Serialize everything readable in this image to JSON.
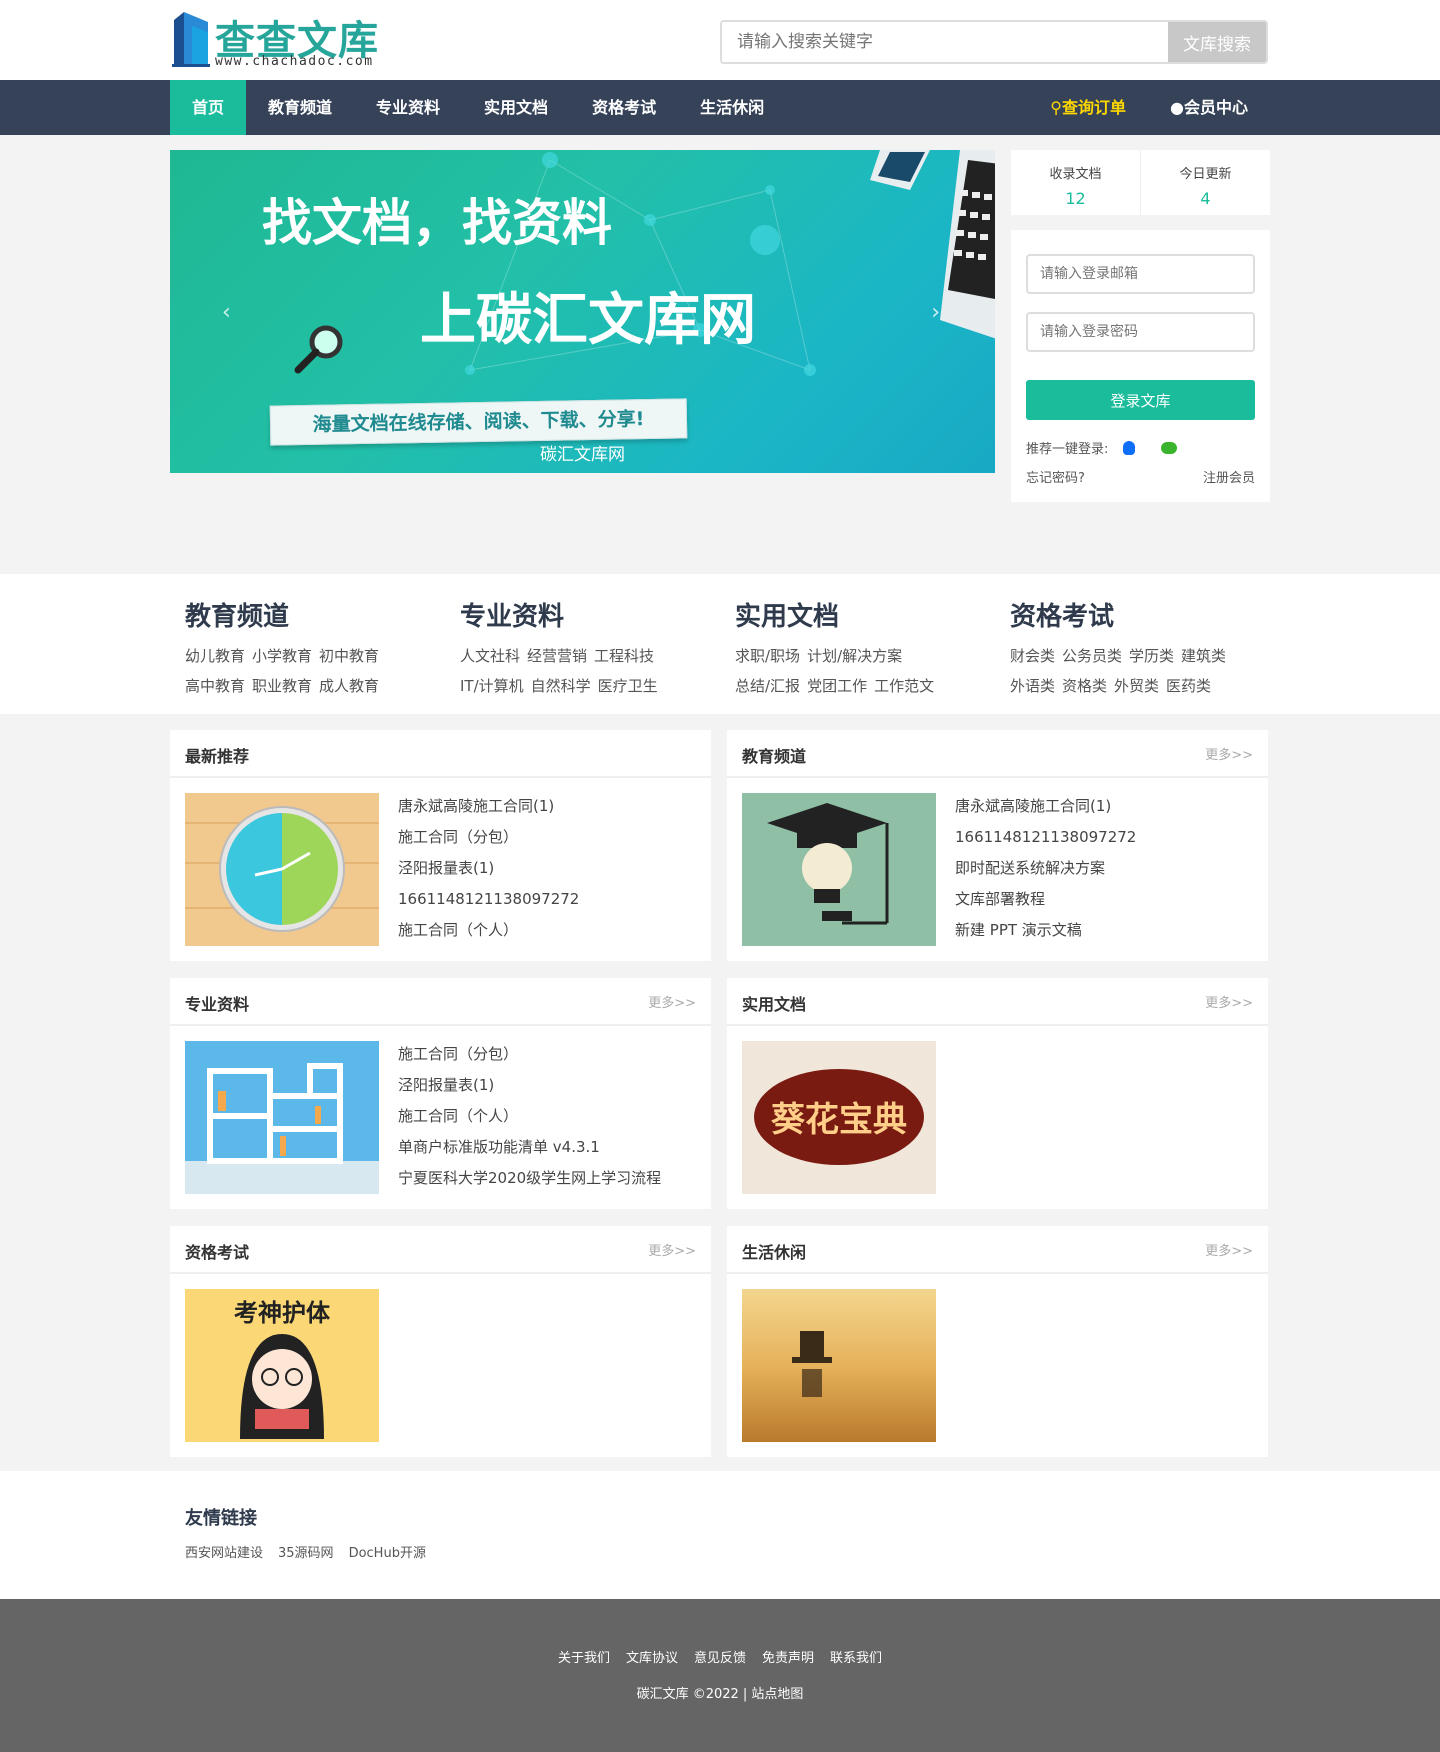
{
  "site": {
    "logo_text": "查查文库",
    "logo_sub": "www.chachadoc.com"
  },
  "search": {
    "placeholder": "请输入搜索关键字",
    "button": "文库搜索"
  },
  "nav": {
    "items": [
      "首页",
      "教育频道",
      "专业资料",
      "实用文档",
      "资格考试",
      "生活休闲"
    ],
    "orders": "查询订单",
    "member": "会员中心"
  },
  "banner": {
    "title1": "找文档，找资料",
    "title2": "上碳汇文库网",
    "ribbon": "海量文档在线存储、阅读、下载、分享!",
    "caption": "碳汇文库网"
  },
  "stats": {
    "docs_label": "收录文档",
    "docs_value": "12",
    "today_label": "今日更新",
    "today_value": "4"
  },
  "login": {
    "email_placeholder": "请输入登录邮箱",
    "password_placeholder": "请输入登录密码",
    "button": "登录文库",
    "social_label": "推荐一键登录:",
    "forgot": "忘记密码?",
    "register": "注册会员"
  },
  "categories": [
    {
      "title": "教育频道",
      "row1": [
        "幼儿教育",
        "小学教育",
        "初中教育"
      ],
      "row2": [
        "高中教育",
        "职业教育",
        "成人教育"
      ]
    },
    {
      "title": "专业资料",
      "row1": [
        "人文社科",
        "经营营销",
        "工程科技"
      ],
      "row2": [
        "IT/计算机",
        "自然科学",
        "医疗卫生"
      ]
    },
    {
      "title": "实用文档",
      "row1": [
        "求职/职场",
        "计划/解决方案"
      ],
      "row2": [
        "总结/汇报",
        "党团工作",
        "工作范文"
      ]
    },
    {
      "title": "资格考试",
      "row1": [
        "财会类",
        "公务员类",
        "学历类",
        "建筑类"
      ],
      "row2": [
        "外语类",
        "资格类",
        "外贸类",
        "医药类"
      ]
    }
  ],
  "panels": [
    {
      "title": "最新推荐",
      "more": "",
      "items": [
        "唐永斌高陵施工合同(1)",
        "施工合同（分包）",
        "泾阳报量表(1)",
        "1661148121138097272",
        "施工合同（个人）"
      ],
      "thumb": "clock"
    },
    {
      "title": "教育频道",
      "more": "更多>>",
      "items": [
        "唐永斌高陵施工合同(1)",
        "1661148121138097272",
        "即时配送系统解决方案",
        "文库部署教程",
        "新建 PPT 演示文稿"
      ],
      "thumb": "graduation"
    },
    {
      "title": "专业资料",
      "more": "更多>>",
      "items": [
        "施工合同（分包）",
        "泾阳报量表(1)",
        "施工合同（个人）",
        "单商户标准版功能清单 v4.3.1",
        "宁夏医科大学2020级学生网上学习流程"
      ],
      "thumb": "shelf"
    },
    {
      "title": "实用文档",
      "more": "更多>>",
      "items": [],
      "thumb": "calligraphy"
    },
    {
      "title": "资格考试",
      "more": "更多>>",
      "items": [],
      "thumb": "exam"
    },
    {
      "title": "生活休闲",
      "more": "更多>>",
      "items": [],
      "thumb": "beach"
    }
  ],
  "thumb_text": {
    "calligraphy": "葵花宝典",
    "exam": "考神护体"
  },
  "friends": {
    "title": "友情链接",
    "links": [
      "西安网站建设",
      "35源码网",
      "DocHub开源"
    ]
  },
  "footer": {
    "links": [
      "关于我们",
      "文库协议",
      "意见反馈",
      "免责声明",
      "联系我们"
    ],
    "copyright": "碳汇文库 ©2022 | 站点地图"
  },
  "colors": {
    "accent": "#1abc9c",
    "nav_bg": "#354258",
    "footer_bg": "#656565",
    "orders": "#ffd700"
  }
}
